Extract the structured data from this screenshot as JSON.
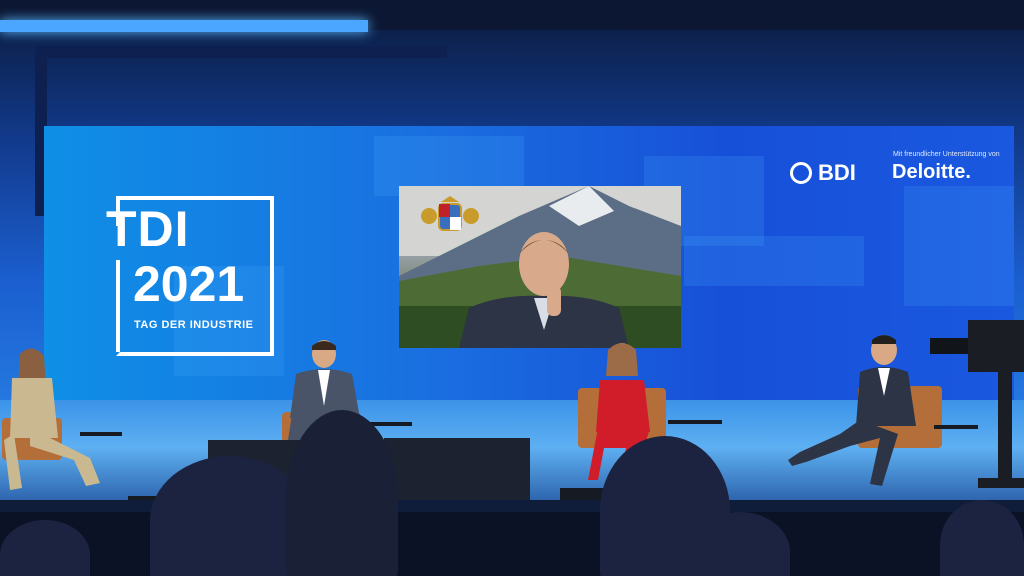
{
  "screen": {
    "logo_title": "TDI",
    "logo_year": "2021",
    "logo_subtitle": "TAG DER INDUSTRIE",
    "partner_logo": "BDI",
    "sponsor_note": "Mit freundlicher Unterstützung von",
    "sponsor_logo": "Deloitte."
  },
  "colors": {
    "screen_blue": "#1a6fe0",
    "deloitte_green": "#86bc25",
    "chair_brown": "#b46e3a",
    "red_suit": "#d11d2a"
  },
  "icons": [
    "bdi-emblem-icon",
    "bavarian-coat-of-arms-icon",
    "tv-camera-icon"
  ]
}
